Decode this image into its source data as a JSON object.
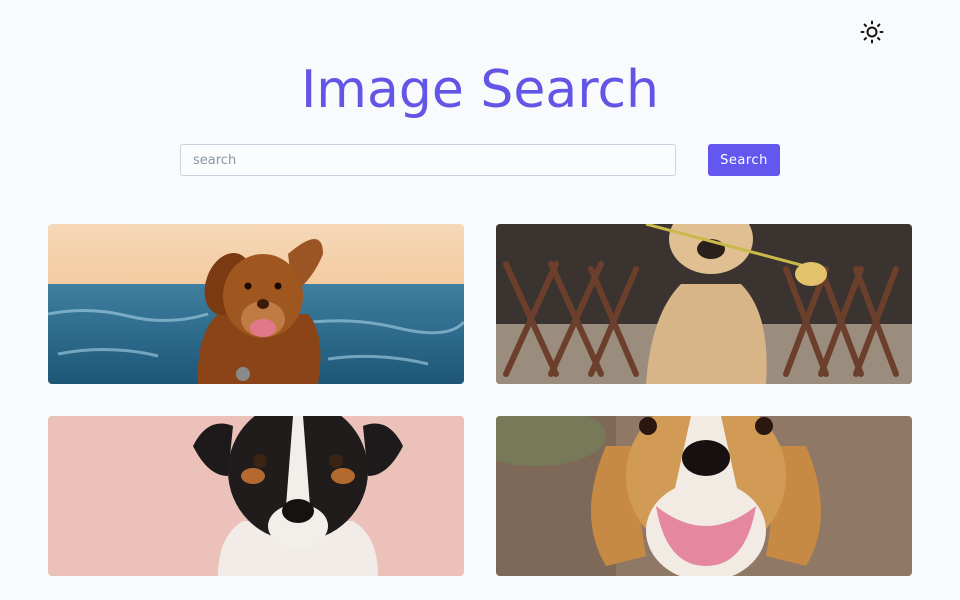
{
  "header": {
    "title": "Image Search",
    "theme_toggle_icon": "sun-icon"
  },
  "search": {
    "placeholder": "search",
    "value": "",
    "button_label": "Search"
  },
  "colors": {
    "accent": "#6357f0",
    "title": "#6355e6",
    "background": "#f8fafc"
  },
  "results": [
    {
      "subject": "dog-photo"
    },
    {
      "subject": "dog-photo"
    },
    {
      "subject": "dog-photo"
    },
    {
      "subject": "dog-photo"
    }
  ]
}
